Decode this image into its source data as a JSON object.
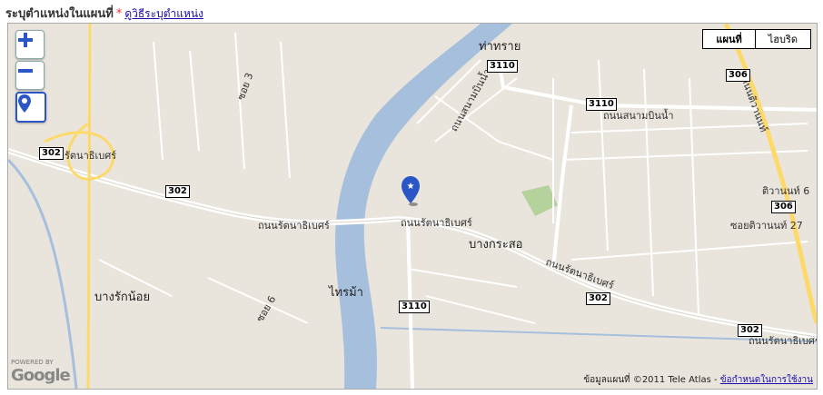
{
  "header": {
    "title": "ระบุตำแหน่งในแผนที่",
    "required_mark": "*",
    "help_link": "ดูวิธีระบุตำแหน่ง"
  },
  "map_type": {
    "map_label": "แผนที่",
    "hybrid_label": "ไฮบริด"
  },
  "places": {
    "tha_sai": "ท่าทราย",
    "bang_kraso": "บางกระสอ",
    "sai_ma": "ไทรม้า",
    "bang_rak_noi": "บางรักน้อย"
  },
  "roads": {
    "rattanathibet_w": "ถนนรัตนาธิเบศร์",
    "rattanathibet_c": "ถนนรัตนาธิเบศร์",
    "rattanathibet_e": "ถนนรัตนาธิเบศร์",
    "rattanathibet_e2": "ถนนรัตนาธิเบศร์",
    "ratthanathibet_interchange": "รัตนาธิเบศร์",
    "sanambinnam": "ถนนสนามบินน้ำ",
    "sanambinnam_n": "ถนนสนามบินน้ำ",
    "tiwanon": "ถนนติวานนท์",
    "tiwanon_soi": "ติวานนท์ 6",
    "soi_tiwanon_27": "ซอยติวานนท์ 27",
    "soi3": "ซอย 3",
    "soi6": "ซอย 6"
  },
  "shields": [
    "3110",
    "3110",
    "3110",
    "306",
    "306",
    "302",
    "302",
    "302",
    "302"
  ],
  "attribution": {
    "copyright": "ข้อมูลแผนที่ ©2011 Tele Atlas",
    "sep": " - ",
    "terms": "ข้อกำหนดในการใช้งาน"
  },
  "google": {
    "powered_by": "POWERED BY",
    "logo": "Google"
  },
  "colors": {
    "land": "#e9e5dc",
    "river": "#a5bfdd",
    "road": "#ffffff",
    "highway": "#fdd96a",
    "park": "#b5d29c",
    "marker": "#2a56c6"
  }
}
